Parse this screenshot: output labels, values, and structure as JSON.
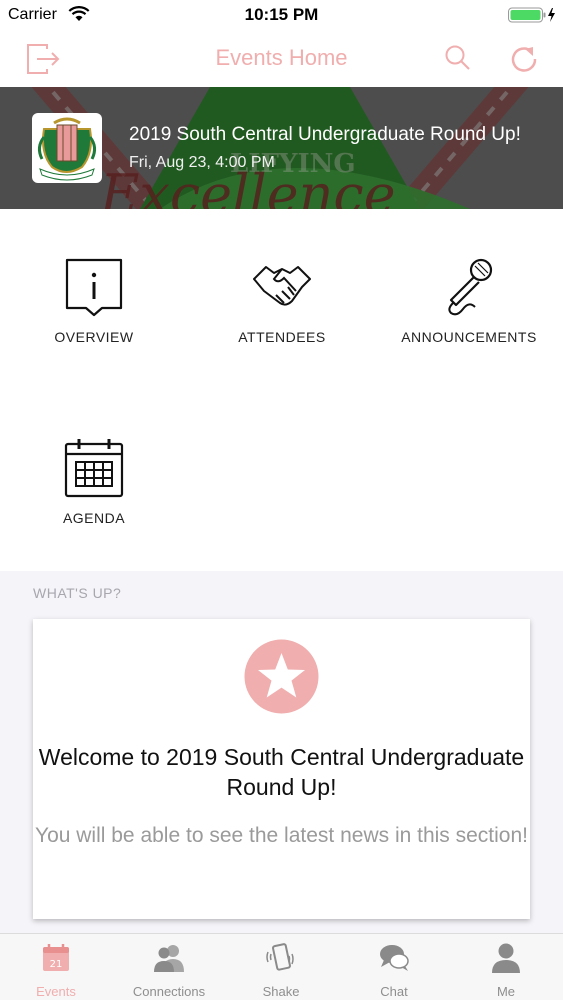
{
  "status_bar": {
    "carrier": "Carrier",
    "time": "10:15 PM"
  },
  "nav": {
    "title": "Events Home",
    "title_color": "#f0aeae",
    "left_icon": "exit-icon",
    "right_icons": [
      "search-icon",
      "refresh-icon"
    ]
  },
  "event": {
    "title": "2019 South Central Undergraduate Round Up!",
    "date": "Fri, Aug 23, 4:00 PM"
  },
  "tiles": [
    {
      "label": "OVERVIEW",
      "icon": "info-icon"
    },
    {
      "label": "ATTENDEES",
      "icon": "handshake-icon"
    },
    {
      "label": "ANNOUNCEMENTS",
      "icon": "microphone-icon"
    },
    {
      "label": "AGENDA",
      "icon": "calendar-icon"
    }
  ],
  "whats_up": {
    "section_label": "WHAT'S UP?",
    "card_title": "Welcome to 2019 South Central Undergraduate Round Up!",
    "card_message": "You will be able to see the latest news in this section!",
    "icon": "star-icon"
  },
  "tab_bar": {
    "active_color": "#f0aeae",
    "tabs": [
      {
        "label": "Events",
        "icon": "calendar-tab-icon",
        "badge": "21",
        "active": true
      },
      {
        "label": "Connections",
        "icon": "people-icon",
        "active": false
      },
      {
        "label": "Shake",
        "icon": "phone-shake-icon",
        "active": false
      },
      {
        "label": "Chat",
        "icon": "chat-icon",
        "active": false
      },
      {
        "label": "Me",
        "icon": "person-icon",
        "active": false
      }
    ]
  }
}
